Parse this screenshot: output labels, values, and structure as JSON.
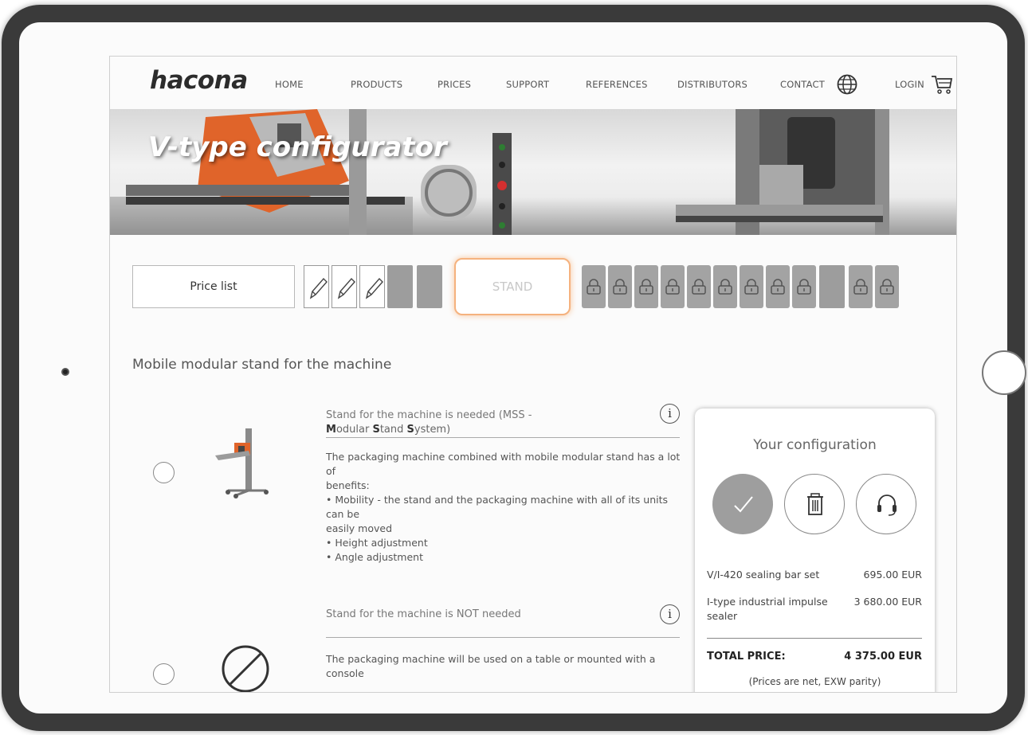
{
  "nav": {
    "logo": "hacona",
    "items": [
      "HOME",
      "PRODUCTS",
      "PRICES",
      "SUPPORT",
      "REFERENCES",
      "DISTRIBUTORS",
      "CONTACT"
    ],
    "login": "LOGIN"
  },
  "hero": {
    "title": "V-type configurator"
  },
  "steps": {
    "price_list": "Price list",
    "current": "STAND"
  },
  "section": {
    "title": "Mobile modular stand for the machine"
  },
  "options": [
    {
      "title_line1": "Stand for the machine is needed (MSS -",
      "title_line2_parts": [
        "M",
        "odular ",
        "S",
        "tand ",
        "S",
        "ystem)"
      ],
      "desc": [
        "The packaging machine combined with mobile modular stand has a lot of",
        "benefits:",
        "• Mobility - the stand and the packaging machine with all of its units can be",
        "easily moved",
        "• Height adjustment",
        "• Angle adjustment"
      ]
    },
    {
      "title_line1": "Stand for the machine is NOT needed",
      "desc": [
        "The packaging machine will be used on a table or mounted with a console"
      ]
    }
  ],
  "config": {
    "title": "Your configuration",
    "items": [
      {
        "name": "V/I-420 sealing bar set",
        "price": "695.00 EUR"
      },
      {
        "name": "I-type industrial impulse sealer",
        "price": "3 680.00 EUR"
      }
    ],
    "total_label": "TOTAL PRICE:",
    "total_price": "4 375.00 EUR",
    "note": "(Prices are net, EXW parity)"
  },
  "colors": {
    "accent_orange": "#f5b27e",
    "grey_step": "#9d9d9d"
  },
  "icons": [
    "globe-icon",
    "cart-icon",
    "pencil-icon",
    "lock-icon",
    "info-icon",
    "check-icon",
    "trash-icon",
    "headset-icon",
    "prohibited-icon"
  ]
}
